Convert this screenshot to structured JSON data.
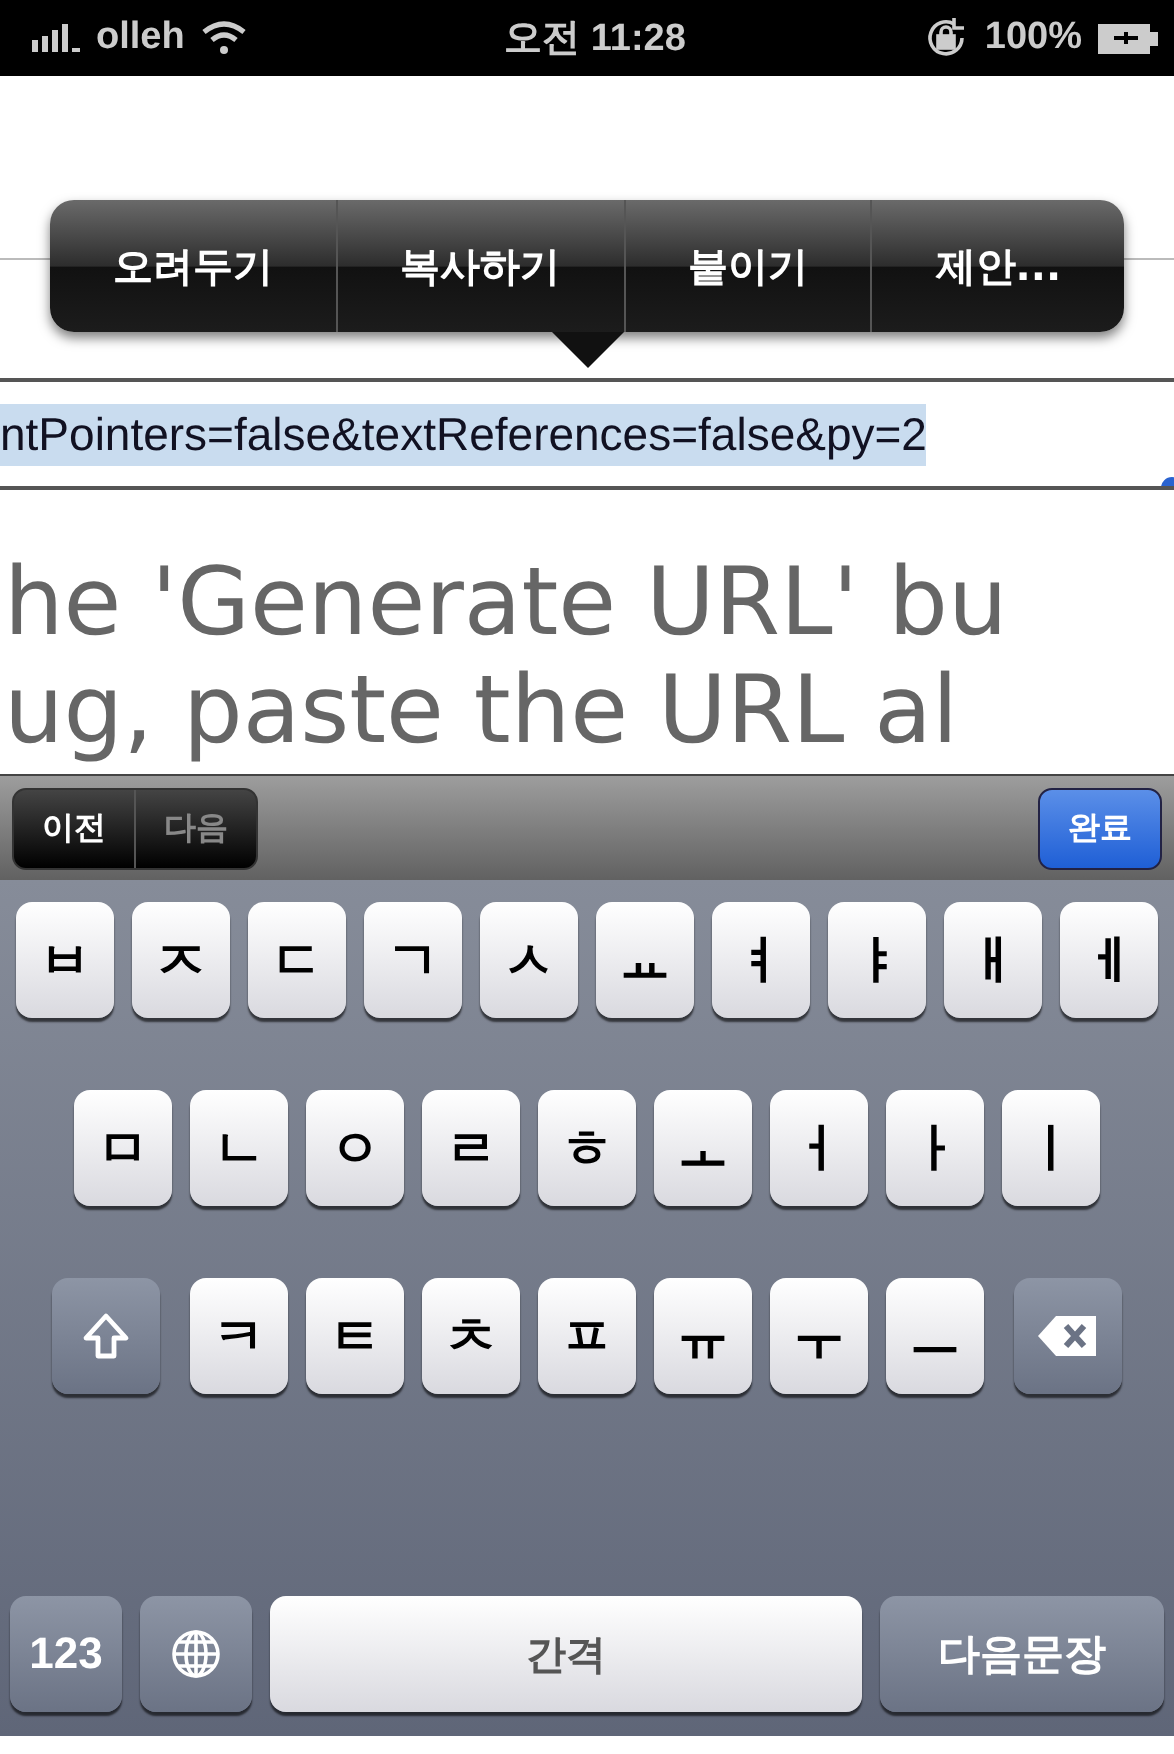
{
  "status_bar": {
    "carrier": "olleh",
    "time": "오전 11:28",
    "battery": "100%"
  },
  "edit_menu": {
    "items": [
      "오려두기",
      "복사하기",
      "붙이기",
      "제안..."
    ]
  },
  "url_field": {
    "value": "ntPointers=false&textReferences=false&py=2"
  },
  "page_text": [
    "he 'Generate URL' bu",
    "ug, paste the URL al"
  ],
  "form_toolbar": {
    "buttons": [
      {
        "label": "이전",
        "disabled": false
      },
      {
        "label": "다음",
        "disabled": true
      }
    ],
    "done": "완료"
  },
  "keyboard": {
    "rows": [
      {
        "keys": [
          {
            "kind": "char",
            "label": "ㅂ"
          },
          {
            "kind": "char",
            "label": "ㅈ"
          },
          {
            "kind": "char",
            "label": "ㄷ"
          },
          {
            "kind": "char",
            "label": "ㄱ"
          },
          {
            "kind": "char",
            "label": "ㅅ"
          },
          {
            "kind": "char",
            "label": "ㅛ"
          },
          {
            "kind": "char",
            "label": "ㅕ"
          },
          {
            "kind": "char",
            "label": "ㅑ"
          },
          {
            "kind": "char",
            "label": "ㅐ"
          },
          {
            "kind": "char",
            "label": "ㅔ"
          }
        ]
      },
      {
        "keys": [
          {
            "kind": "char",
            "label": "ㅁ"
          },
          {
            "kind": "char",
            "label": "ㄴ"
          },
          {
            "kind": "char",
            "label": "ㅇ"
          },
          {
            "kind": "char",
            "label": "ㄹ"
          },
          {
            "kind": "char",
            "label": "ㅎ"
          },
          {
            "kind": "char",
            "label": "ㅗ"
          },
          {
            "kind": "char",
            "label": "ㅓ"
          },
          {
            "kind": "char",
            "label": "ㅏ"
          },
          {
            "kind": "char",
            "label": "ㅣ"
          }
        ]
      },
      {
        "keys": [
          {
            "kind": "shift"
          },
          {
            "kind": "char",
            "label": "ㅋ"
          },
          {
            "kind": "char",
            "label": "ㅌ"
          },
          {
            "kind": "char",
            "label": "ㅊ"
          },
          {
            "kind": "char",
            "label": "ㅍ"
          },
          {
            "kind": "char",
            "label": "ㅠ"
          },
          {
            "kind": "char",
            "label": "ㅜ"
          },
          {
            "kind": "char",
            "label": "ㅡ"
          },
          {
            "kind": "backspace"
          }
        ]
      },
      {
        "keys": [
          {
            "kind": "mode",
            "label": "123"
          },
          {
            "kind": "globe"
          },
          {
            "kind": "space",
            "label": "간격"
          },
          {
            "kind": "return",
            "label": "다음문장"
          }
        ]
      }
    ]
  }
}
